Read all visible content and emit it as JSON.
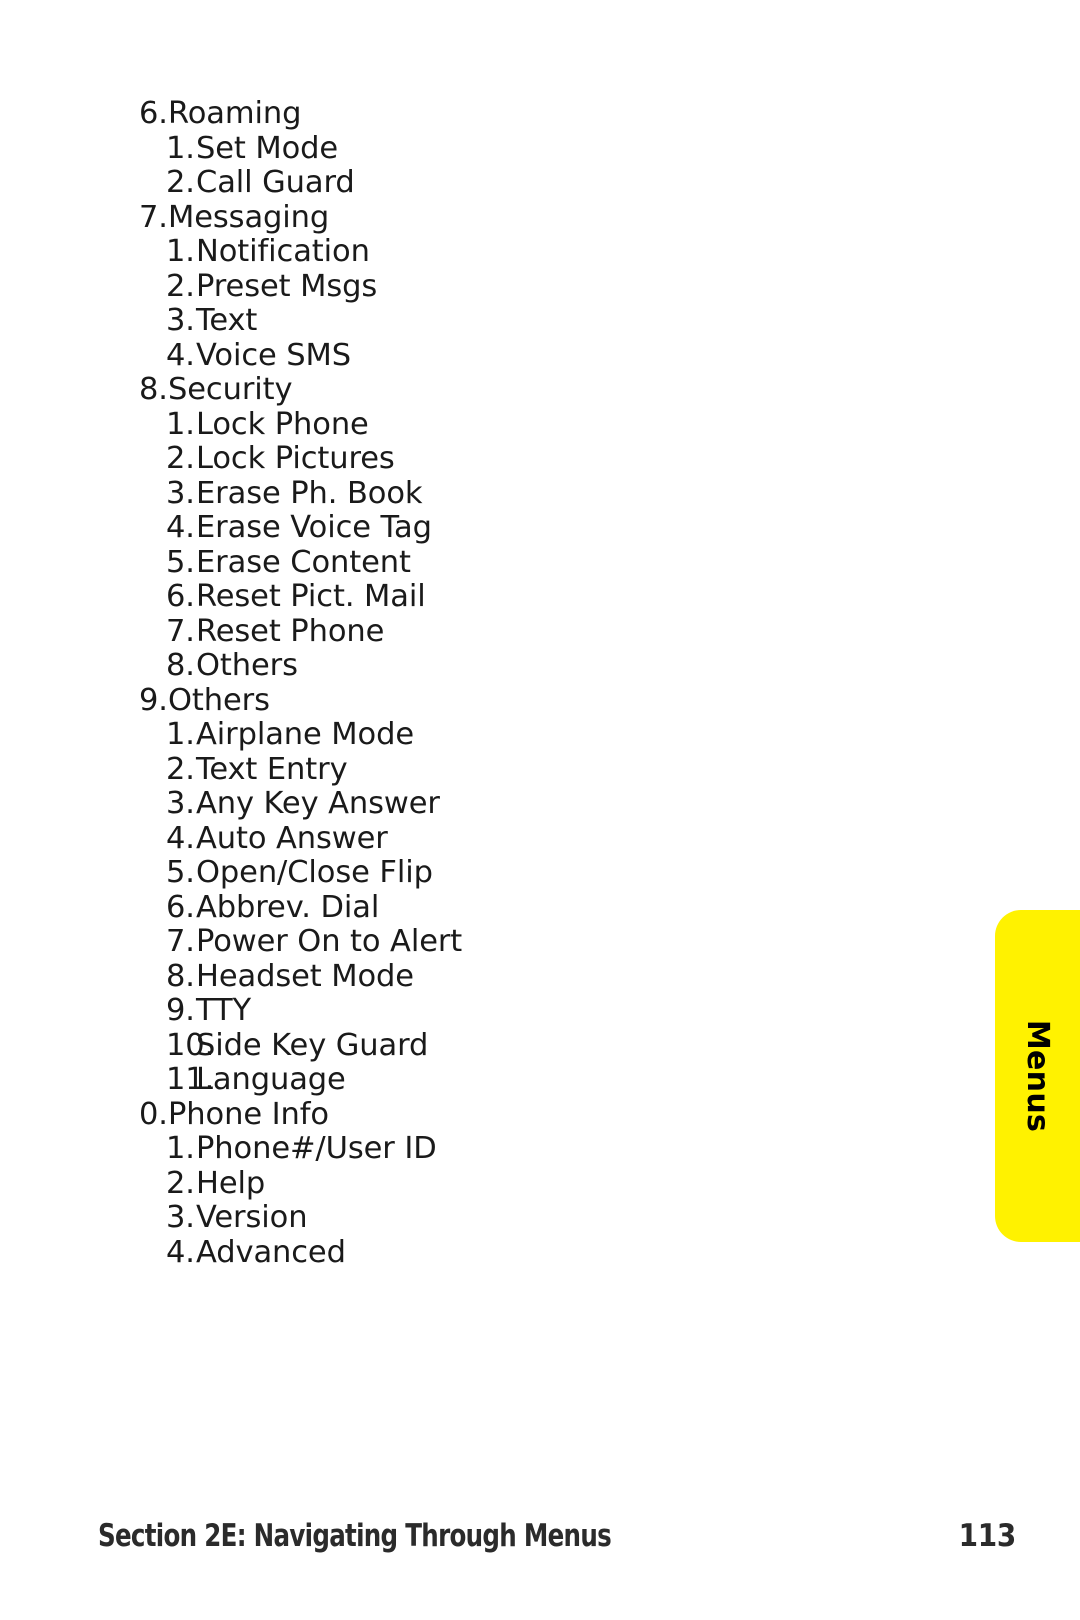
{
  "page": {
    "background_color": "#ffffff",
    "text_color": "#1a1a1a"
  },
  "side_tab": {
    "label": "Menus",
    "color": "#fff200",
    "text_color": "#000000"
  },
  "outline": {
    "rows": [
      {
        "level": 1,
        "num": "6.",
        "label": "Roaming"
      },
      {
        "level": 2,
        "num": "1.",
        "label": "Set Mode"
      },
      {
        "level": 2,
        "num": "2.",
        "label": "Call Guard"
      },
      {
        "level": 1,
        "num": "7.",
        "label": "Messaging"
      },
      {
        "level": 2,
        "num": "1.",
        "label": "Notification"
      },
      {
        "level": 2,
        "num": "2.",
        "label": "Preset Msgs"
      },
      {
        "level": 2,
        "num": "3.",
        "label": "Text"
      },
      {
        "level": 2,
        "num": "4.",
        "label": "Voice SMS"
      },
      {
        "level": 1,
        "num": "8.",
        "label": "Security"
      },
      {
        "level": 2,
        "num": "1.",
        "label": "Lock Phone"
      },
      {
        "level": 2,
        "num": "2.",
        "label": "Lock Pictures"
      },
      {
        "level": 2,
        "num": "3.",
        "label": "Erase Ph. Book"
      },
      {
        "level": 2,
        "num": "4.",
        "label": "Erase Voice Tag"
      },
      {
        "level": 2,
        "num": "5.",
        "label": "Erase Content"
      },
      {
        "level": 2,
        "num": "6.",
        "label": "Reset Pict. Mail"
      },
      {
        "level": 2,
        "num": "7.",
        "label": "Reset Phone"
      },
      {
        "level": 2,
        "num": "8.",
        "label": "Others"
      },
      {
        "level": 1,
        "num": "9.",
        "label": "Others"
      },
      {
        "level": 2,
        "num": "1.",
        "label": "Airplane Mode"
      },
      {
        "level": 2,
        "num": "2.",
        "label": "Text Entry"
      },
      {
        "level": 2,
        "num": "3.",
        "label": "Any Key Answer"
      },
      {
        "level": 2,
        "num": "4.",
        "label": "Auto Answer"
      },
      {
        "level": 2,
        "num": "5.",
        "label": "Open/Close Flip"
      },
      {
        "level": 2,
        "num": "6.",
        "label": "Abbrev. Dial"
      },
      {
        "level": 2,
        "num": "7.",
        "label": "Power On to Alert"
      },
      {
        "level": 2,
        "num": "8.",
        "label": "Headset Mode"
      },
      {
        "level": 2,
        "num": "9.",
        "label": "TTY"
      },
      {
        "level": 2,
        "num": "10.",
        "label": "Side Key Guard"
      },
      {
        "level": 2,
        "num": "11.",
        "label": "Language"
      },
      {
        "level": 1,
        "num": "0.",
        "label": "Phone Info"
      },
      {
        "level": 2,
        "num": "1.",
        "label": "Phone#/User ID"
      },
      {
        "level": 2,
        "num": "2.",
        "label": "Help"
      },
      {
        "level": 2,
        "num": "3.",
        "label": "Version"
      },
      {
        "level": 2,
        "num": "4.",
        "label": "Advanced"
      }
    ]
  },
  "footer": {
    "title": "Section 2E: Navigating Through Menus",
    "page_number": "113"
  }
}
